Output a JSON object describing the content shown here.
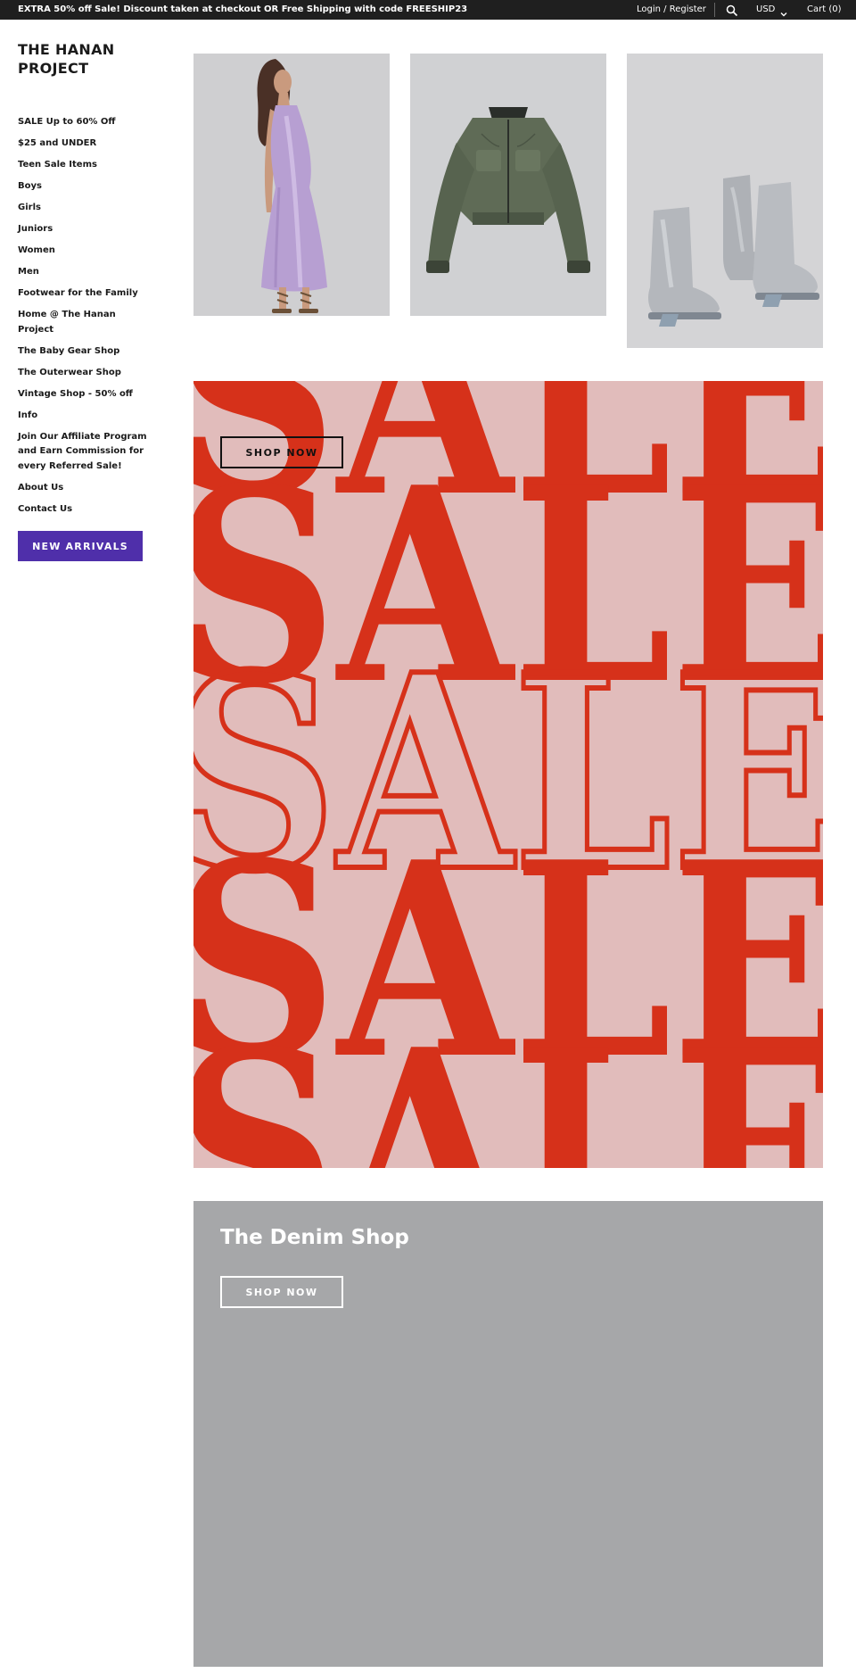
{
  "topbar": {
    "announcement": "EXTRA 50% off Sale! Discount taken at checkout OR Free Shipping with code FREESHIP23",
    "login": "Login / Register",
    "currency": "USD",
    "cart": "Cart (0)",
    "icons": {
      "search": "search-icon",
      "currency_toggle": "chevron-down-icon"
    }
  },
  "brand": {
    "name": "THE HANAN PROJECT"
  },
  "nav": {
    "items": [
      "SALE Up to 60% Off",
      "$25 and UNDER",
      "Teen Sale Items",
      "Boys",
      "Girls",
      "Juniors",
      "Women",
      "Men",
      "Footwear for the Family",
      "Home @ The Hanan Project",
      "The Baby Gear Shop",
      "The Outerwear Shop",
      "Vintage Shop - 50% off",
      "Info",
      "Join Our Affiliate Program and Earn Commission for every Referred Sale!",
      "About Us",
      "Contact Us"
    ],
    "cta": "NEW ARRIVALS",
    "cta_color": "#4f2faa"
  },
  "sale_banner": {
    "button": "SHOP NOW",
    "background": "#e1bcbb",
    "accent": "#d6311a"
  },
  "denim": {
    "title": "The Denim Shop",
    "button": "SHOP NOW",
    "background": "#a6a7a9"
  }
}
